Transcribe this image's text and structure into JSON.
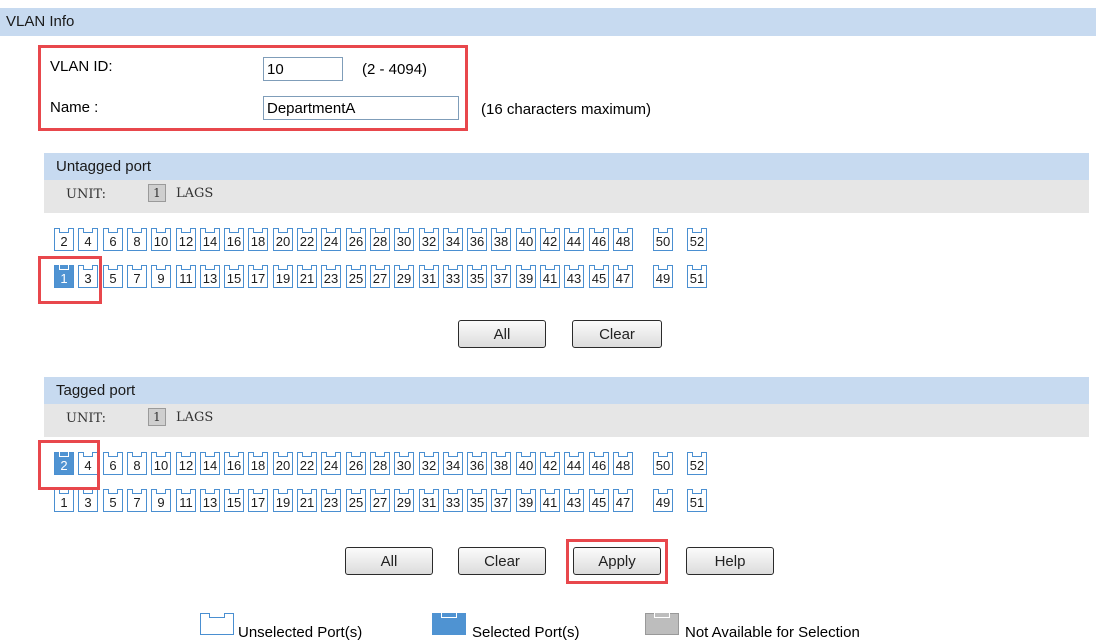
{
  "vlan_info": {
    "title": "VLAN Info",
    "id_label": "VLAN ID:",
    "id_value": "10",
    "id_hint": "(2 - 4094)",
    "name_label": "Name :",
    "name_value": "DepartmentA",
    "name_hint": "(16 characters maximum)"
  },
  "untagged": {
    "title": "Untagged port",
    "unit_label": "UNIT:",
    "unit_value": "1",
    "lags_label": "LAGS",
    "selected_ports": [
      "1"
    ],
    "all_label": "All",
    "clear_label": "Clear"
  },
  "tagged": {
    "title": "Tagged port",
    "unit_label": "UNIT:",
    "unit_value": "1",
    "lags_label": "LAGS",
    "selected_ports": [
      "2"
    ],
    "all_label": "All",
    "clear_label": "Clear"
  },
  "ports": {
    "even": [
      "2",
      "4",
      "6",
      "8",
      "10",
      "12",
      "14",
      "16",
      "18",
      "20",
      "22",
      "24",
      "26",
      "28",
      "30",
      "32",
      "34",
      "36",
      "38",
      "40",
      "42",
      "44",
      "46",
      "48",
      "50",
      "52"
    ],
    "odd": [
      "1",
      "3",
      "5",
      "7",
      "9",
      "11",
      "13",
      "15",
      "17",
      "19",
      "21",
      "23",
      "25",
      "27",
      "29",
      "31",
      "33",
      "35",
      "37",
      "39",
      "41",
      "43",
      "45",
      "47",
      "49",
      "51"
    ]
  },
  "actions": {
    "apply_label": "Apply",
    "help_label": "Help"
  },
  "legend": {
    "unselected": "Unselected Port(s)",
    "selected": "Selected Port(s)",
    "not_available": "Not Available for Selection"
  },
  "colors": {
    "header_bg": "#c7daf0",
    "port_border": "#4a8fd1",
    "port_selected": "#4f93d2",
    "highlight": "#e8474c"
  }
}
